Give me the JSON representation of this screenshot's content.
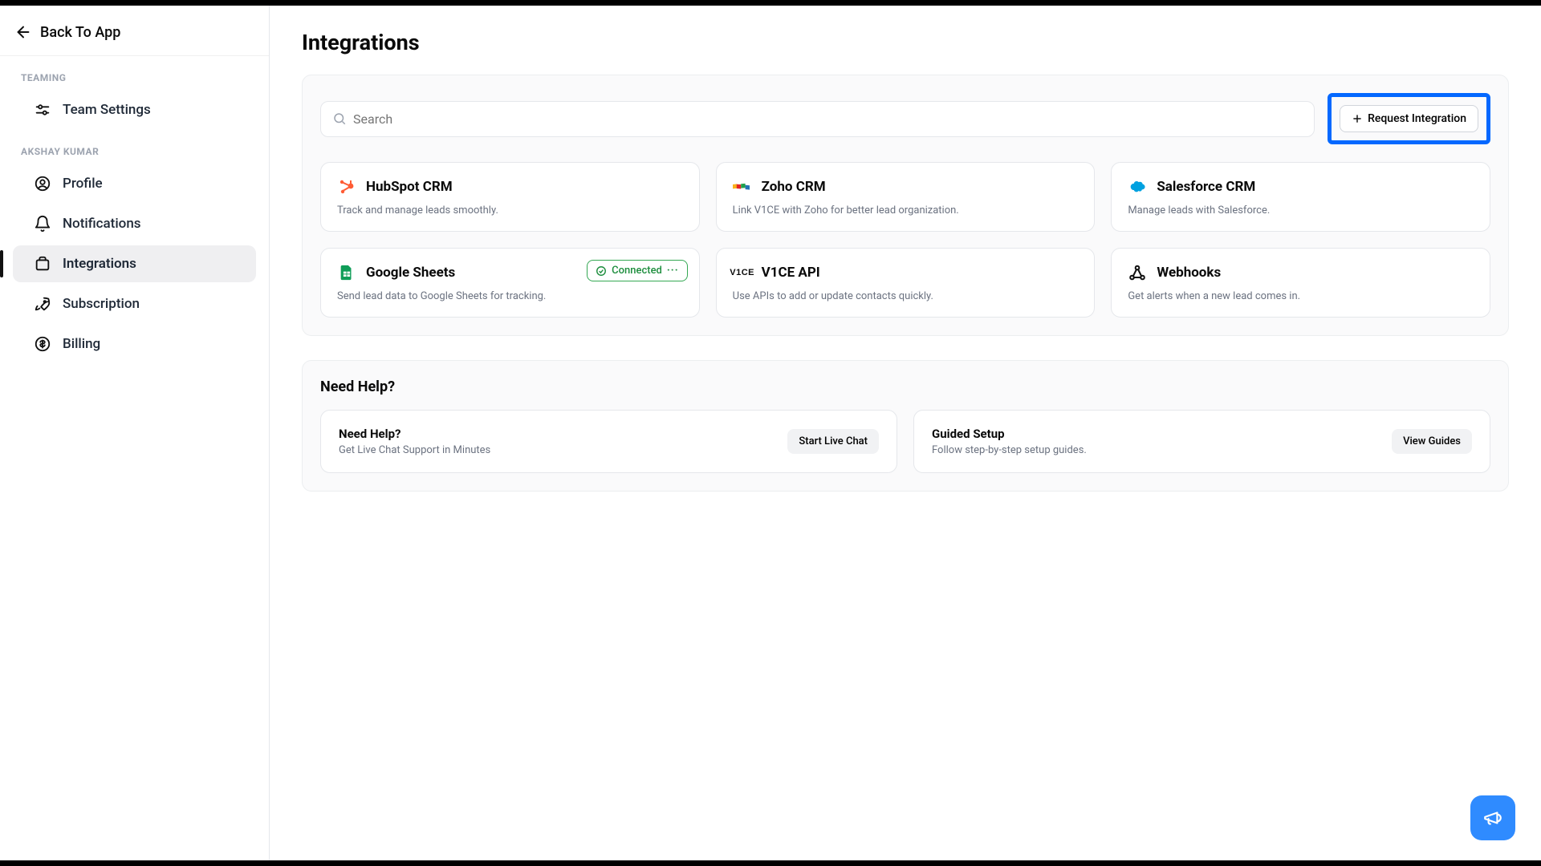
{
  "header": {
    "back_label": "Back To App"
  },
  "sidebar": {
    "section1_label": "TEAMING",
    "section2_label": "AKSHAY KUMAR",
    "items1": [
      {
        "label": "Team Settings"
      }
    ],
    "items2": [
      {
        "label": "Profile"
      },
      {
        "label": "Notifications"
      },
      {
        "label": "Integrations"
      },
      {
        "label": "Subscription"
      },
      {
        "label": "Billing"
      }
    ]
  },
  "page": {
    "title": "Integrations"
  },
  "search": {
    "placeholder": "Search"
  },
  "request_button": "Request Integration",
  "integrations": [
    {
      "name": "HubSpot CRM",
      "desc": "Track and manage leads smoothly."
    },
    {
      "name": "Zoho CRM",
      "desc": "Link V1CE with Zoho for better lead organization."
    },
    {
      "name": "Salesforce CRM",
      "desc": "Manage leads with Salesforce."
    },
    {
      "name": "Google Sheets",
      "desc": "Send lead data to Google Sheets for tracking.",
      "connected_label": "Connected"
    },
    {
      "name": "V1CE API",
      "desc": "Use APIs to add or update contacts quickly."
    },
    {
      "name": "Webhooks",
      "desc": "Get alerts when a new lead comes in."
    }
  ],
  "help": {
    "section_title": "Need Help?",
    "cards": [
      {
        "title": "Need Help?",
        "desc": "Get Live Chat Support in Minutes",
        "button": "Start Live Chat"
      },
      {
        "title": "Guided Setup",
        "desc": "Follow step-by-step setup guides.",
        "button": "View Guides"
      }
    ]
  }
}
